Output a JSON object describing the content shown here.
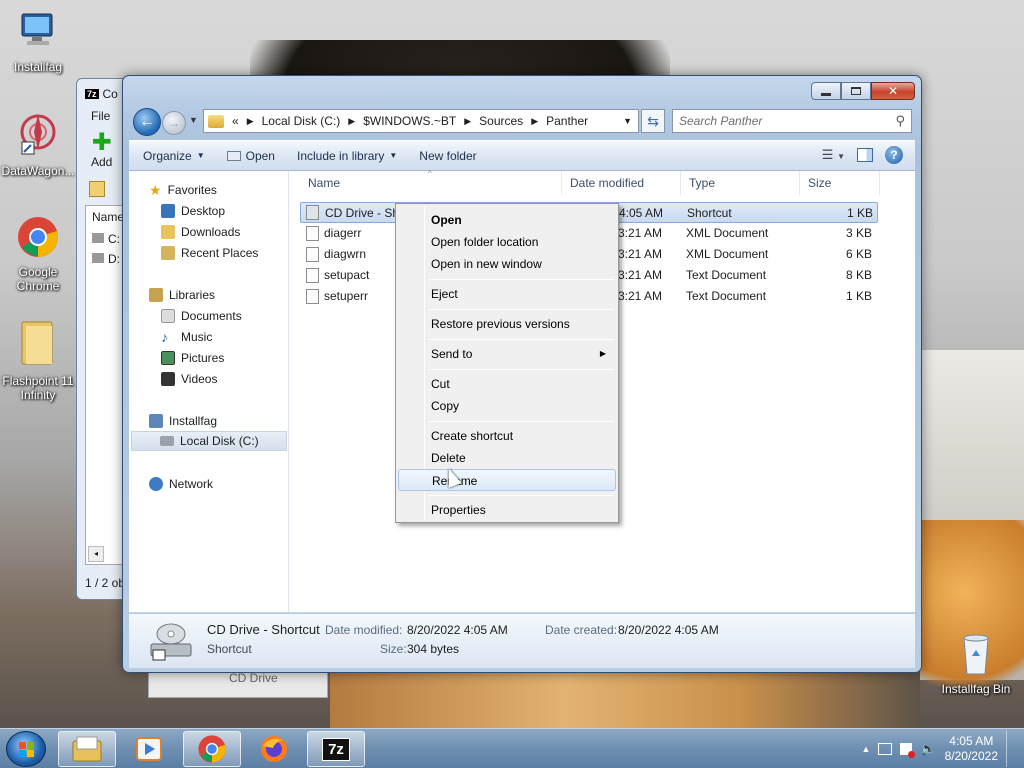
{
  "desktop": {
    "icons": [
      {
        "name": "installfag",
        "label": "Installfag"
      },
      {
        "name": "datawagon",
        "label": "DataWagon..."
      },
      {
        "name": "chrome",
        "label": "Google Chrome"
      },
      {
        "name": "flashpoint",
        "label": "Flashpoint 11 Infinity"
      },
      {
        "name": "recycle-bin",
        "label": "Installfag Bin"
      }
    ]
  },
  "bg_window": {
    "title": "Co",
    "menu_file": "File",
    "add_label": "Add",
    "col_name": "Name",
    "drive_c": "C:",
    "drive_d": "D:",
    "status": "1 / 2 ob",
    "ghost_label": "CD Drive"
  },
  "explorer": {
    "address": {
      "overflow": "«",
      "segments": [
        "Local Disk (C:)",
        "$WINDOWS.~BT",
        "Sources",
        "Panther"
      ]
    },
    "search_placeholder": "Search Panther",
    "toolbar": {
      "organize": "Organize",
      "open": "Open",
      "include_in_library": "Include in library",
      "new_folder": "New folder"
    },
    "nav": {
      "favorites": "Favorites",
      "desktop": "Desktop",
      "downloads": "Downloads",
      "recent_places": "Recent Places",
      "libraries": "Libraries",
      "documents": "Documents",
      "music": "Music",
      "pictures": "Pictures",
      "videos": "Videos",
      "computer": "Installfag",
      "local_disk": "Local Disk (C:)",
      "network": "Network"
    },
    "columns": {
      "name": "Name",
      "date_modified": "Date modified",
      "type": "Type",
      "size": "Size"
    },
    "files": [
      {
        "name": "CD Drive - Sh",
        "date": "4:05 AM",
        "type": "Shortcut",
        "size": "1 KB"
      },
      {
        "name": "diagerr",
        "date": "3:21 AM",
        "type": "XML Document",
        "size": "3 KB"
      },
      {
        "name": "diagwrn",
        "date": "3:21 AM",
        "type": "XML Document",
        "size": "6 KB"
      },
      {
        "name": "setupact",
        "date": "3:21 AM",
        "type": "Text Document",
        "size": "8 KB"
      },
      {
        "name": "setuperr",
        "date": "3:21 AM",
        "type": "Text Document",
        "size": "1 KB"
      }
    ],
    "details": {
      "name": "CD Drive - Shortcut",
      "type": "Shortcut",
      "date_modified_label": "Date modified:",
      "date_modified": "8/20/2022 4:05 AM",
      "date_created_label": "Date created:",
      "date_created": "8/20/2022 4:05 AM",
      "size_label": "Size:",
      "size": "304 bytes"
    }
  },
  "context_menu": {
    "open": "Open",
    "open_folder_location": "Open folder location",
    "open_in_new_window": "Open in new window",
    "eject": "Eject",
    "restore_previous_versions": "Restore previous versions",
    "send_to": "Send to",
    "cut": "Cut",
    "copy": "Copy",
    "create_shortcut": "Create shortcut",
    "delete": "Delete",
    "rename": "Rename",
    "properties": "Properties"
  },
  "taskbar": {
    "time": "4:05 AM",
    "date": "8/20/2022",
    "sevenzip_label": "7z"
  },
  "colors": {
    "selection": "#c8daf2",
    "taskbar": "#6f8fb1",
    "window_frame": "#b2c8e2"
  }
}
